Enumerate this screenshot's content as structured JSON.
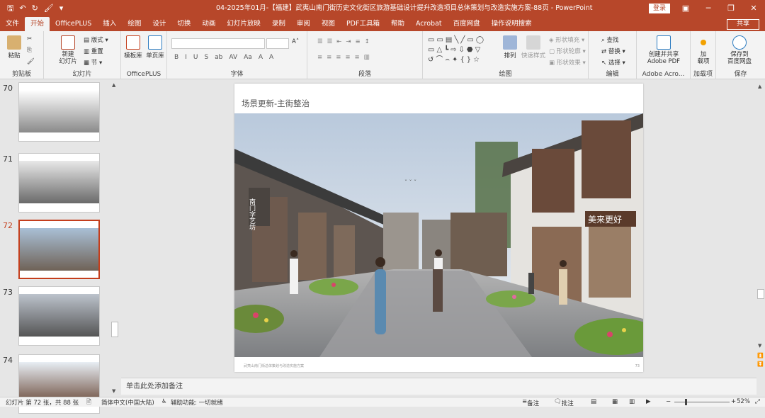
{
  "window": {
    "title": "04-2025年01月-【福建】武夷山南门街历史文化街区旅游基础设计提升改造项目总体策划与改造实施方案-88页 - PowerPoint",
    "login_label": "登录",
    "share_label": "共享"
  },
  "tabs": [
    "文件",
    "开始",
    "OfficePLUS",
    "插入",
    "绘图",
    "设计",
    "切换",
    "动画",
    "幻灯片放映",
    "录制",
    "审阅",
    "视图",
    "PDF工具箱",
    "帮助",
    "Acrobat",
    "百度网盘",
    "操作说明搜索"
  ],
  "active_tab": "开始",
  "ribbon": {
    "clipboard": {
      "label": "剪贴板",
      "paste": "粘贴"
    },
    "slides": {
      "label": "幻灯片",
      "new_slide": "新建\n幻灯片",
      "layout": "版式",
      "reset": "重置",
      "section": "节"
    },
    "officeplus": {
      "label": "OfficePLUS",
      "template_lib": "模板库",
      "single_page_lib": "单页库"
    },
    "font": {
      "label": "字体",
      "buttons": [
        "B",
        "I",
        "U",
        "S",
        "ab",
        "AV",
        "Aa",
        "A",
        "A"
      ]
    },
    "paragraph": {
      "label": "段落"
    },
    "drawing": {
      "label": "绘图",
      "arrange": "排列",
      "quick_styles": "快速样式",
      "shape_fill": "形状填充",
      "shape_outline": "形状轮廓",
      "shape_effects": "形状效果"
    },
    "editing": {
      "label": "编辑",
      "find": "查找",
      "replace": "替换",
      "select": "选择"
    },
    "adobe": {
      "label": "Adobe Acro...",
      "create_share": "创建并共享\nAdobe PDF"
    },
    "addins": {
      "label": "加载项",
      "addin": "加\n载项"
    },
    "save": {
      "label": "保存",
      "save_baidu": "保存到\n百度网盘"
    }
  },
  "thumbnails": [
    {
      "number": "70",
      "active": false
    },
    {
      "number": "71",
      "active": false
    },
    {
      "number": "72",
      "active": true
    },
    {
      "number": "73",
      "active": false
    },
    {
      "number": "74",
      "active": false
    }
  ],
  "slide": {
    "heading": "场景更新-主街整治",
    "footer_left": "武夷山南门街总体策划与改造实施方案",
    "footer_right": "73",
    "sign_left": "南门字艺坊",
    "sign_right": "美来更好"
  },
  "notes_placeholder": "单击此处添加备注",
  "status": {
    "slide_info": "幻灯片 第 72 张，共 88 张",
    "language": "简体中文(中国大陆)",
    "accessibility": "辅助功能: 一切就绪",
    "notes_btn": "备注",
    "comments_btn": "批注",
    "zoom": "52%"
  },
  "colors": {
    "accent": "#b7472a",
    "active_thumb": "#c43e1c"
  }
}
